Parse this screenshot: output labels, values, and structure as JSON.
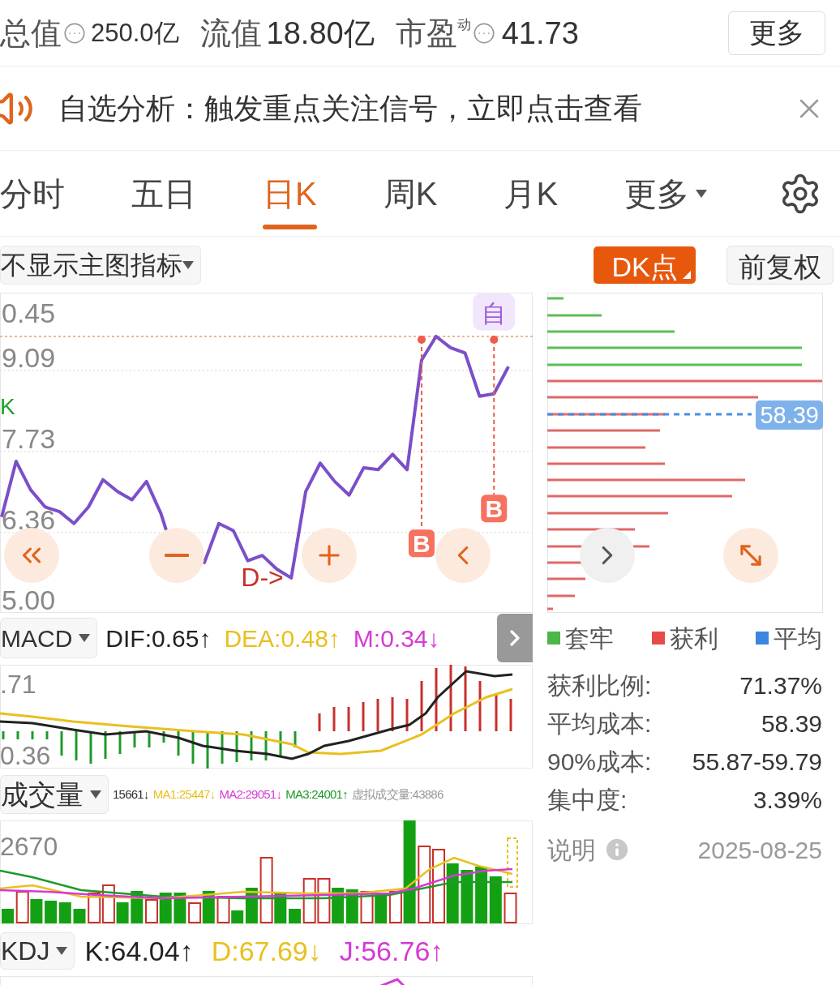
{
  "header": {
    "stats": [
      {
        "label": "总值",
        "value": "250.0亿",
        "info": true
      },
      {
        "label": "流值",
        "value": "18.80亿",
        "info": false
      },
      {
        "label": "市盈",
        "sup": "动",
        "value": "41.73",
        "info": true
      }
    ],
    "more_button": "更多"
  },
  "notice": {
    "text": "自选分析：触发重点关注信号，立即点击查看"
  },
  "tabs": [
    {
      "label": "分时",
      "selected": false,
      "dropdown": false
    },
    {
      "label": "五日",
      "selected": false,
      "dropdown": false
    },
    {
      "label": "日K",
      "selected": true,
      "dropdown": false
    },
    {
      "label": "周K",
      "selected": false,
      "dropdown": false
    },
    {
      "label": "月K",
      "selected": false,
      "dropdown": false
    },
    {
      "label": "更多",
      "selected": false,
      "dropdown": true
    }
  ],
  "toolbar": {
    "indicator_select": "不显示主图指标",
    "dk_button": "DK点",
    "adjust_button": "前复权"
  },
  "main_chart": {
    "axis_labels": [
      "0.45",
      "9.09",
      "7.73",
      "6.36",
      "5.00"
    ],
    "signals": [
      {
        "kind": "buy",
        "text": "B"
      },
      {
        "kind": "buy",
        "text": "B"
      },
      {
        "kind": "tag",
        "text": "自"
      },
      {
        "kind": "text",
        "text": "D->"
      },
      {
        "kind": "mark",
        "text": "K"
      }
    ]
  },
  "chips": {
    "avg_label": "58.39"
  },
  "macd": {
    "select": "MACD",
    "values": [
      {
        "text": "DIF:0.65↑",
        "color": "#222222"
      },
      {
        "text": "DEA:0.48↑",
        "color": "#e8c020"
      },
      {
        "text": "M:0.34↓",
        "color": "#d63ad6"
      }
    ],
    "axis_labels": [
      ".71",
      "0.36"
    ]
  },
  "legend": [
    {
      "label": "套牢",
      "color": "#4cb648"
    },
    {
      "label": "获利",
      "color": "#e84a4a"
    },
    {
      "label": "平均",
      "color": "#3a86e0"
    }
  ],
  "stats": [
    {
      "label": "获利比例:",
      "value": "71.37%"
    },
    {
      "label": "平均成本:",
      "value": "58.39"
    },
    {
      "label": "90%成本:",
      "value": "55.87-59.79"
    },
    {
      "label": "集中度:",
      "value": "3.39%"
    }
  ],
  "volume": {
    "select": "成交量",
    "values": [
      {
        "text": "15661↓",
        "color": "#333333"
      },
      {
        "text": "MA1:25447↓",
        "color": "#e8c020"
      },
      {
        "text": "MA2:29051↓",
        "color": "#d63ad6"
      },
      {
        "text": "MA3:24001↑",
        "color": "#1f9a2a"
      },
      {
        "text": "虚拟成交量:43886",
        "color": "#999999"
      }
    ],
    "axis_labels": [
      "2670"
    ]
  },
  "note": {
    "label": "说明",
    "date": "2025-08-25"
  },
  "kdj": {
    "select": "KDJ",
    "values": [
      {
        "text": "K:64.04↑",
        "color": "#222222"
      },
      {
        "text": "D:67.69↓",
        "color": "#e8c020"
      },
      {
        "text": "J:56.76↑",
        "color": "#d63ad6"
      }
    ]
  }
}
